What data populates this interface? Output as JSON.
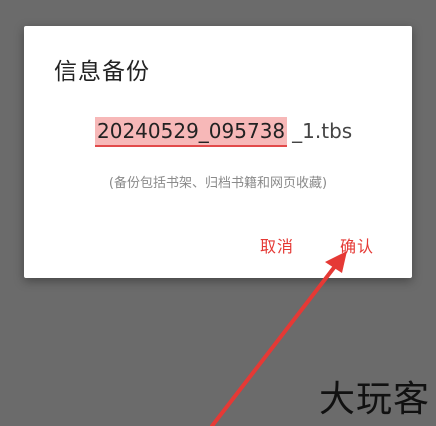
{
  "dialog": {
    "title": "信息备份",
    "filename_value": "20240529_095738",
    "filename_suffix": "_1.tbs",
    "hint": "(备份包括书架、归档书籍和网页收藏)",
    "cancel_label": "取消",
    "confirm_label": "确认"
  },
  "annotation": {
    "arrow_color": "#e53935",
    "watermark": "大玩客"
  },
  "colors": {
    "accent": "#e53935",
    "overlay": "#6b6b6b",
    "selection_highlight": "#f7b8b8"
  }
}
